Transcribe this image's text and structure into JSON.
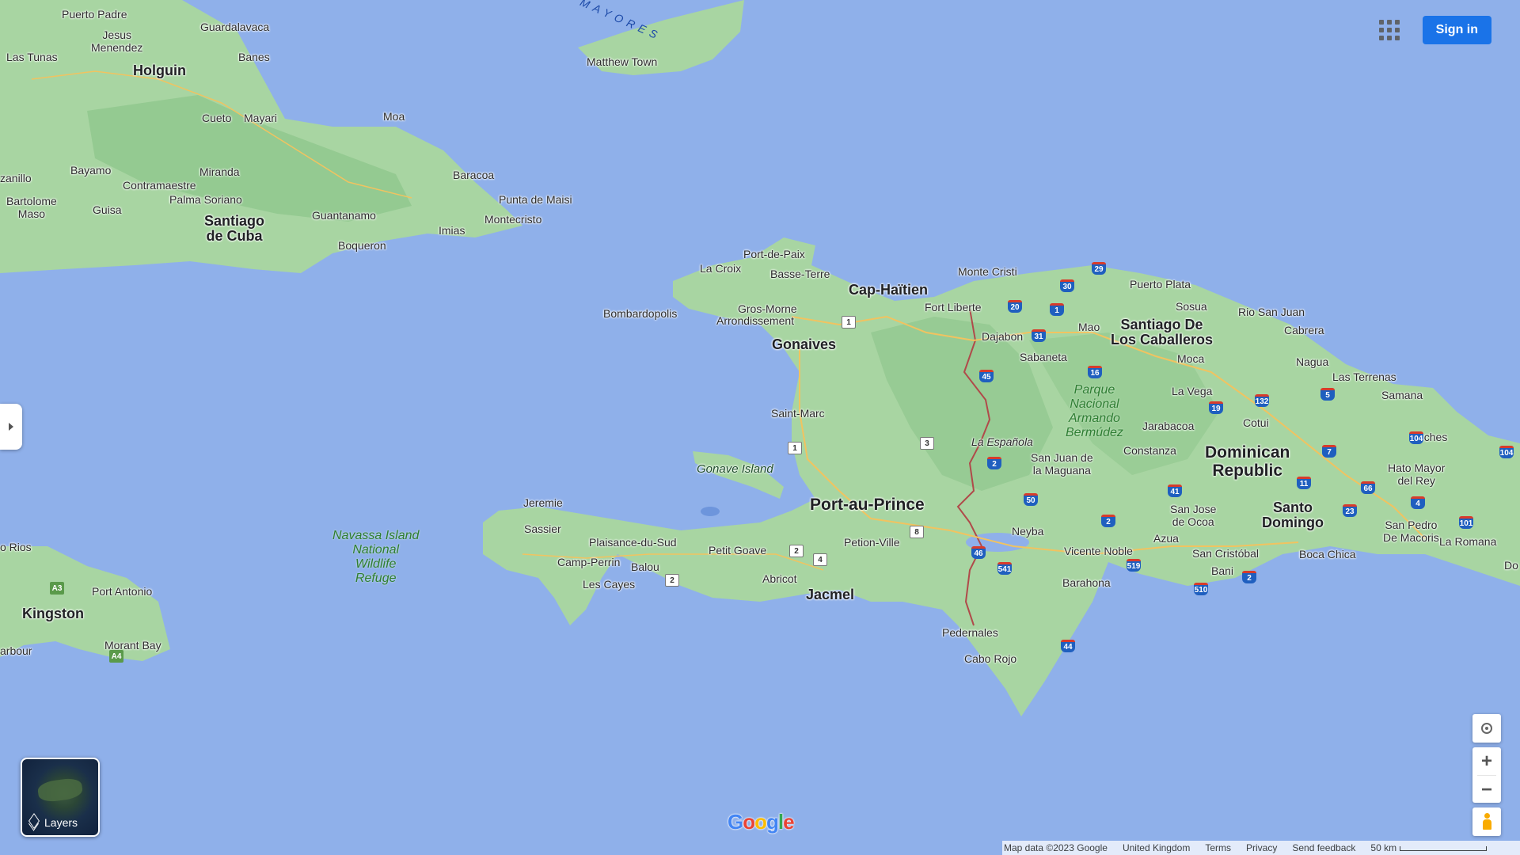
{
  "header": {
    "sign_in_label": "Sign in"
  },
  "map": {
    "colors": {
      "water": "#8fb0ea",
      "land": "#a8d5a2",
      "land_dark": "#8cc58a",
      "border": "#b04a4a"
    },
    "cuba": {
      "puerto_padre": "Puerto Padre",
      "guardalavaca": "Guardalavaca",
      "jesus_menendez": "Jesus\nMenendez",
      "las_tunas": "Las Tunas",
      "holguin": "Holguin",
      "banes": "Banes",
      "cueto": "Cueto",
      "mayari": "Mayari",
      "moa": "Moa",
      "zanillo": "zanillo",
      "bayamo": "Bayamo",
      "miranda": "Miranda",
      "contramaestre": "Contramaestre",
      "palma_soriano": "Palma Soriano",
      "baracoa": "Baracoa",
      "punta_de_maisi": "Punta de Maisi",
      "bartolome_maso": "Bartolome\nMaso",
      "guisa": "Guisa",
      "santiago_de_cuba": "Santiago\nde Cuba",
      "guantanamo": "Guantanamo",
      "montecristo": "Montecristo",
      "imias": "Imias",
      "boqueron": "Boqueron"
    },
    "bahamas": {
      "sea_label": "AS MAYORES",
      "matthew_town": "Matthew Town"
    },
    "haiti": {
      "port_de_paix": "Port-de-Paix",
      "la_croix": "La Croix",
      "basse_terre": "Basse-Terre",
      "cap_haitien": "Cap-Haïtien",
      "bombardopolis": "Bombardopolis",
      "gros_morne": "Gros-Morne",
      "arrondissement": "Arrondissement",
      "gonaives": "Gonaives",
      "saint_marc": "Saint-Marc",
      "gonave_island": "Gonave Island",
      "jeremie": "Jeremie",
      "sassier": "Sassier",
      "plaisance_du_sud": "Plaisance-du-Sud",
      "petit_goave": "Petit Goave",
      "camp_perrin": "Camp-Perrin",
      "balou": "Balou",
      "les_cayes": "Les Cayes",
      "abricot": "Abricot",
      "jacmel": "Jacmel",
      "port_au_prince": "Port-au-Prince",
      "petion_ville": "Petion-Ville",
      "navassa": "Navassa Island\nNational\nWildlife\nRefuge"
    },
    "dominican_republic": {
      "monte_cristi": "Monte Cristi",
      "fort_liberte": "Fort Liberte",
      "dajabon": "Dajabon",
      "puerto_plata": "Puerto Plata",
      "sosua": "Sosua",
      "mao": "Mao",
      "santiago": "Santiago De\nLos Caballeros",
      "rio_san_juan": "Rio San Juan",
      "cabrera": "Cabrera",
      "sabaneta": "Sabaneta",
      "moca": "Moca",
      "nagua": "Nagua",
      "las_terrenas": "Las Terrenas",
      "samana": "Samana",
      "la_vega": "La Vega",
      "parque": "Parque\nNacional\nArmando\nBermúdez",
      "jarabacoa": "Jarabacoa",
      "cotui": "Cotui",
      "la_espanola": "La Española",
      "miches": "Miches",
      "country": "Dominican\nRepublic",
      "constanza": "Constanza",
      "san_juan": "San Juan de\nla Maguana",
      "hato_mayor": "Hato Mayor\ndel Rey",
      "neyba": "Neyba",
      "san_jose_de_ocoa": "San Jose\nde Ocoa",
      "santo_domingo": "Santo\nDomingo",
      "azua": "Azua",
      "vicente_noble": "Vicente Noble",
      "san_cristobal": "San Cristóbal",
      "san_pedro": "San Pedro\nDe Macoris",
      "la_romana": "La Romana",
      "boca_chica": "Boca Chica",
      "bani": "Bani",
      "barahona": "Barahona",
      "pedernales": "Pedernales",
      "cabo_rojo": "Cabo Rojo",
      "do": "Do"
    },
    "jamaica": {
      "o_rios": "o Rios",
      "port_antonio": "Port Antonio",
      "kingston": "Kingston",
      "morant_bay": "Morant Bay",
      "arbour": "arbour"
    },
    "shields": {
      "a3": "A3",
      "a4": "A4",
      "h1a": "1",
      "h1b": "1",
      "h3": "3",
      "h2a": "2",
      "h2b": "2",
      "h4": "4",
      "h8": "8",
      "d29": "29",
      "d30": "30",
      "d20": "20",
      "d1": "1",
      "d31": "31",
      "d45": "45",
      "d16": "16",
      "d19": "19",
      "d132": "132",
      "d5": "5",
      "d104a": "104",
      "d104b": "104",
      "d7": "7",
      "d2a": "2",
      "d50": "50",
      "d41": "41",
      "d11": "11",
      "d66": "66",
      "d4": "4",
      "d23": "23",
      "d101": "101",
      "d2b": "2",
      "d46": "46",
      "d541": "541",
      "d519": "519",
      "d510": "510",
      "d2c": "2",
      "d44": "44"
    }
  },
  "controls": {
    "layers_label": "Layers"
  },
  "footer": {
    "map_data": "Map data ©2023 Google",
    "region": "United Kingdom",
    "terms": "Terms",
    "privacy": "Privacy",
    "feedback": "Send feedback",
    "scale": "50 km"
  }
}
